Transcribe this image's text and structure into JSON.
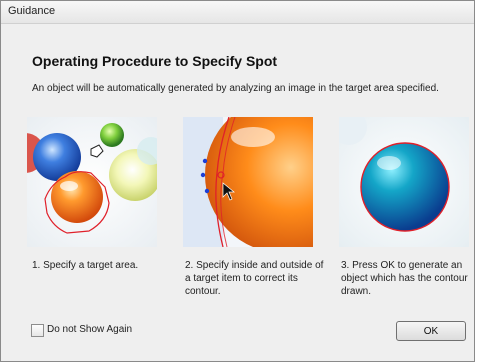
{
  "window": {
    "title": "Guidance"
  },
  "header": {
    "title": "Operating Procedure to Specify Spot",
    "description": "An object will be automatically generated by analyzing an image in the target area specified."
  },
  "steps": [
    {
      "caption": "1. Specify a target area."
    },
    {
      "caption": "2. Specify inside and outside of a target item to correct its contour."
    },
    {
      "caption": "3. Press OK to generate an object which has the contour drawn."
    }
  ],
  "footer": {
    "checkbox_label": "Do not Show Again",
    "checkbox_checked": false,
    "ok_label": "OK"
  },
  "colors": {
    "contour": "#e0202a",
    "marker_inside": "#1c3fd6",
    "window_bg": "#efefef"
  }
}
